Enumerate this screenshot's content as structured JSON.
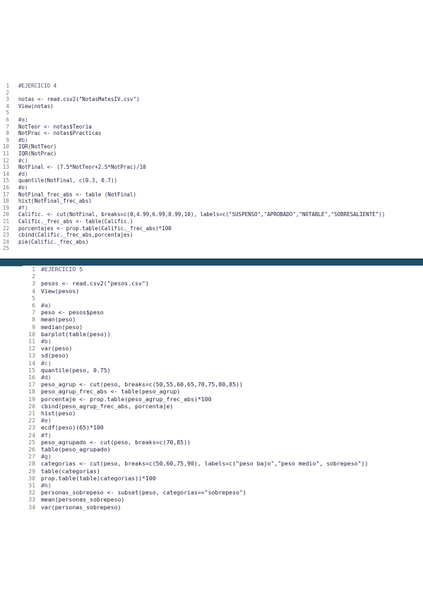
{
  "editor1": {
    "lines": [
      {
        "n": "1",
        "text": "#EJERCICIO 4",
        "type": "comment"
      },
      {
        "n": "2",
        "text": "",
        "type": "code"
      },
      {
        "n": "3",
        "text": "notas <- read.csv2(\"NotasMatesIV.csv\")",
        "type": "code"
      },
      {
        "n": "4",
        "text": "View(notas)",
        "type": "code"
      },
      {
        "n": "5",
        "text": "",
        "type": "code"
      },
      {
        "n": "6",
        "text": "#a)",
        "type": "comment"
      },
      {
        "n": "7",
        "text": "NotTeor <- notas$Teoria",
        "type": "code"
      },
      {
        "n": "8",
        "text": "NotPrac <- notas$Practicas",
        "type": "code"
      },
      {
        "n": "9",
        "text": "#b)",
        "type": "comment"
      },
      {
        "n": "10",
        "text": "IQR(NotTeor)",
        "type": "code"
      },
      {
        "n": "11",
        "text": "IQR(NotPrac)",
        "type": "code"
      },
      {
        "n": "12",
        "text": "#c)",
        "type": "comment"
      },
      {
        "n": "13",
        "text": "NotFinal <- (7.5*NotTeor+2.5*NotPrac)/10",
        "type": "code"
      },
      {
        "n": "14",
        "text": "#d)",
        "type": "comment"
      },
      {
        "n": "15",
        "text": "quantile(NotFinal, c(0.3, 0.7))",
        "type": "code"
      },
      {
        "n": "16",
        "text": "#e)",
        "type": "comment"
      },
      {
        "n": "17",
        "text": "NotFinal_frec_abs <- table (NotFinal)",
        "type": "code"
      },
      {
        "n": "18",
        "text": "hist(NotFinal_frec_abs)",
        "type": "code"
      },
      {
        "n": "19",
        "text": "#f)",
        "type": "comment"
      },
      {
        "n": "20",
        "text": "Calific. <- cut(NotFinal, breaks=c(0,4.99,6.99,8.99,10), labels=c(\"SUSPENSO\",\"APROBADO\",\"NOTABLE\",\"SOBRESALIENTE\"))",
        "type": "code"
      },
      {
        "n": "21",
        "text": "Calific._frec_abs <- table(Calific.)",
        "type": "code"
      },
      {
        "n": "22",
        "text": "porcentajes <- prop.table(Calific._frec_abs)*100",
        "type": "code"
      },
      {
        "n": "23",
        "text": "cbind(Calific._frec_abs,porcentajes)",
        "type": "code"
      },
      {
        "n": "24",
        "text": "pie(Calific._frec_abs)",
        "type": "code"
      },
      {
        "n": "25",
        "text": "",
        "type": "code"
      }
    ]
  },
  "editor2": {
    "lines": [
      {
        "n": "1",
        "text": "#EJERCICIO 5",
        "type": "comment"
      },
      {
        "n": "2",
        "text": "",
        "type": "code"
      },
      {
        "n": "3",
        "text": "pesos <- read.csv2(\"pesos.csv\")",
        "type": "code"
      },
      {
        "n": "4",
        "text": "View(pesos)",
        "type": "code"
      },
      {
        "n": "5",
        "text": "",
        "type": "code"
      },
      {
        "n": "6",
        "text": "#a)",
        "type": "comment"
      },
      {
        "n": "7",
        "text": "peso <- pesos$peso",
        "type": "code"
      },
      {
        "n": "8",
        "text": "mean(peso)",
        "type": "code"
      },
      {
        "n": "9",
        "text": "median(peso)",
        "type": "code"
      },
      {
        "n": "10",
        "text": "barplot(table(peso))",
        "type": "code"
      },
      {
        "n": "11",
        "text": "#b)",
        "type": "comment"
      },
      {
        "n": "12",
        "text": "var(peso)",
        "type": "code"
      },
      {
        "n": "13",
        "text": "sd(peso)",
        "type": "code"
      },
      {
        "n": "14",
        "text": "#c)",
        "type": "comment"
      },
      {
        "n": "15",
        "text": "quantile(peso, 0.75)",
        "type": "code"
      },
      {
        "n": "16",
        "text": "#d)",
        "type": "comment"
      },
      {
        "n": "17",
        "text": "peso_agrup <- cut(peso, breaks=c(50,55,60,65,70,75,80,85))",
        "type": "code"
      },
      {
        "n": "18",
        "text": "peso_agrup_frec_abs <- table(peso_agrup)",
        "type": "code"
      },
      {
        "n": "19",
        "text": "porcentaje <- prop.table(peso_agrup_frec_abs)*100",
        "type": "code"
      },
      {
        "n": "20",
        "text": "cbind(peso_agrup_frec_abs, porcentaje)",
        "type": "code"
      },
      {
        "n": "21",
        "text": "hist(peso)",
        "type": "code"
      },
      {
        "n": "22",
        "text": "#e)",
        "type": "comment"
      },
      {
        "n": "23",
        "text": "ecdf(peso)(65)*100",
        "type": "code"
      },
      {
        "n": "24",
        "text": "#f)",
        "type": "comment"
      },
      {
        "n": "25",
        "text": "peso_agrupado <- cut(peso, breaks=c(70,85))",
        "type": "code"
      },
      {
        "n": "26",
        "text": "table(peso_agrupado)",
        "type": "code"
      },
      {
        "n": "27",
        "text": "#g)",
        "type": "comment"
      },
      {
        "n": "28",
        "text": "categorias <- cut(peso, breaks=c(50,60,75,90), labels=c(\"peso bajo\",\"peso medio\", sobrepeso\"))",
        "type": "code"
      },
      {
        "n": "29",
        "text": "table(categorias)",
        "type": "code"
      },
      {
        "n": "30",
        "text": "prop.table(table(categorias))*100",
        "type": "code"
      },
      {
        "n": "31",
        "text": "#h)",
        "type": "comment"
      },
      {
        "n": "32",
        "text": "personas_sobrepeso <- subset(peso, categorias==\"sobrepeso\")",
        "type": "code"
      },
      {
        "n": "33",
        "text": "mean(personas_sobrepeso)",
        "type": "code"
      },
      {
        "n": "34",
        "text": "var(personas_sobrepeso)",
        "type": "code"
      }
    ]
  },
  "colors": {
    "divider": "#1f4e66",
    "code": "#1c1c3a",
    "line_number": "#7a7a7a"
  }
}
